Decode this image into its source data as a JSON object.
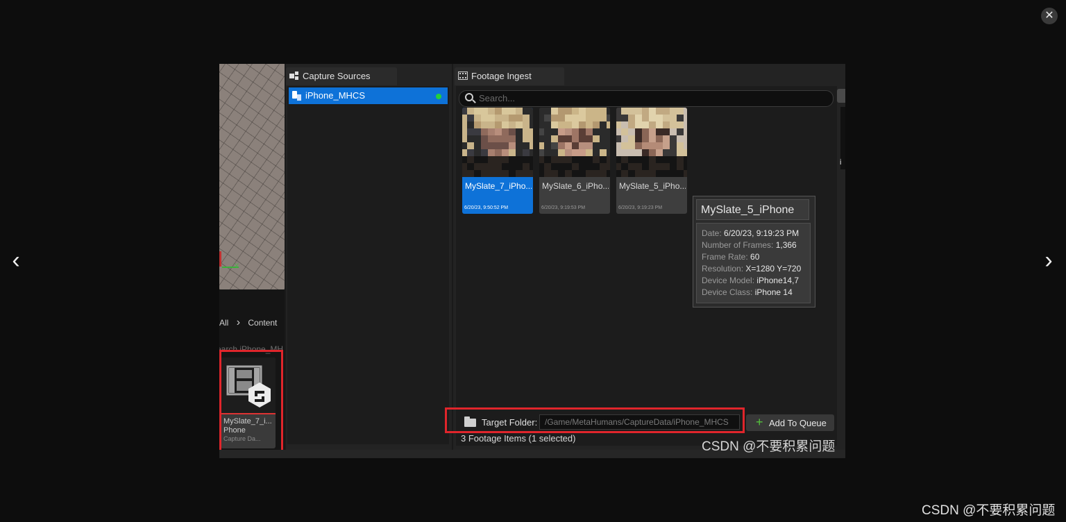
{
  "lightbox": {
    "close_glyph": "✕",
    "prev_glyph": "‹",
    "next_glyph": "›",
    "watermark": "CSDN @不要积累问题"
  },
  "viewport": {
    "axis_label": "Y"
  },
  "content_browser": {
    "breadcrumb_all": "All",
    "breadcrumb_sep": "›",
    "breadcrumb_content": "Content",
    "search_fragment": "earch iPhone_MH",
    "asset": {
      "name": "MySlate_7_i... Phone",
      "type": "Capture Da..."
    }
  },
  "capture_sources": {
    "tab_label": "Capture Sources",
    "items": [
      {
        "label": "iPhone_MHCS",
        "status_color": "#23d13a"
      }
    ]
  },
  "footage_ingest": {
    "tab_label": "Footage Ingest",
    "search_placeholder": "Search...",
    "items": [
      {
        "title": "MySlate_7_iPho...",
        "date": "6/20/23, 9:50:52 PM",
        "selected": true
      },
      {
        "title": "MySlate_6_iPho...",
        "date": "6/20/23, 9:19:53 PM",
        "selected": false
      },
      {
        "title": "MySlate_5_iPho...",
        "date": "6/20/23, 9:19:23 PM",
        "selected": false
      }
    ],
    "tooltip": {
      "title": "MySlate_5_iPhone",
      "rows": [
        {
          "label": "Date:",
          "value": "6/20/23, 9:19:23 PM"
        },
        {
          "label": "Number of Frames:",
          "value": "1,366"
        },
        {
          "label": "Frame Rate:",
          "value": "60"
        },
        {
          "label": "Resolution:",
          "value": "X=1280 Y=720"
        },
        {
          "label": "Device Model:",
          "value": "iPhone14,7"
        },
        {
          "label": "Device Class:",
          "value": "iPhone 14"
        }
      ]
    },
    "target_folder_label": "Target Folder:",
    "target_folder_value": "/Game/MetaHumans/CaptureData/iPhone_MHCS",
    "add_to_queue_label": "Add To Queue",
    "status": "3 Footage Items (1 selected)",
    "watermark": "CSDN @不要积累问题"
  },
  "colors": {
    "accent": "#0e72d8",
    "highlight": "#e0252b",
    "online": "#23d13a"
  }
}
